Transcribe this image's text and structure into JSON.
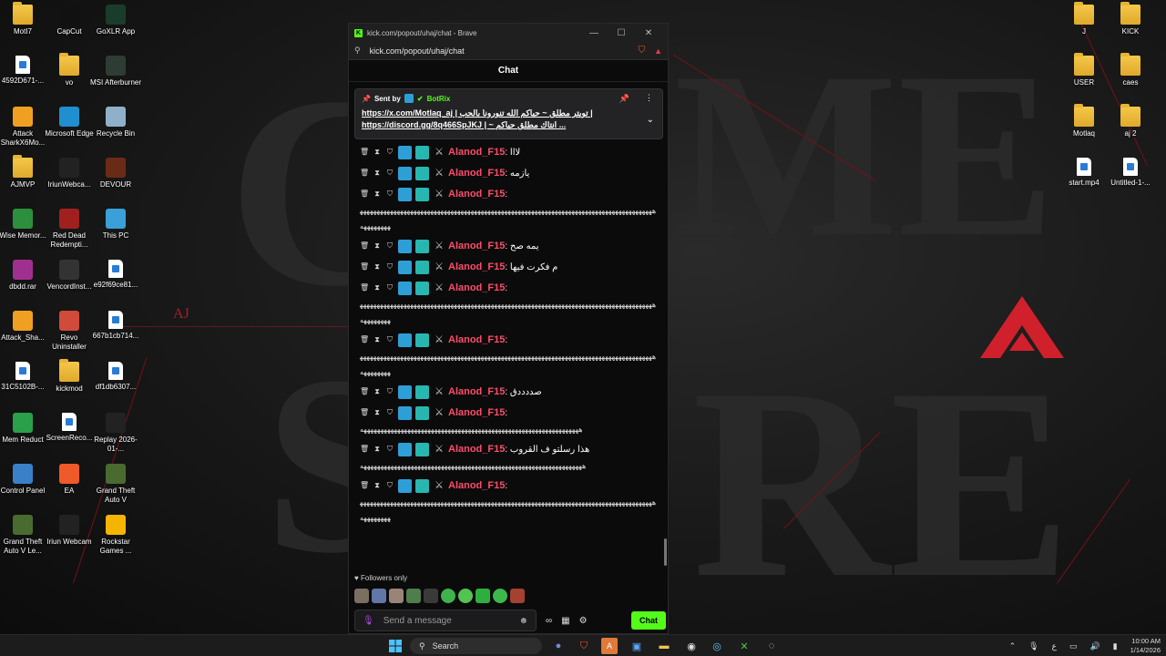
{
  "desktop": {
    "left_icons": [
      {
        "label": "MotI7",
        "type": "folder"
      },
      {
        "label": "CapCut",
        "type": "app"
      },
      {
        "label": "GoXLR App",
        "type": "app"
      },
      {
        "label": "4592D671-...",
        "type": "file"
      },
      {
        "label": "vo",
        "type": "folder"
      },
      {
        "label": "MSI Afterburner",
        "type": "app"
      },
      {
        "label": "Attack SharkX6Mo...",
        "type": "app"
      },
      {
        "label": "Microsoft Edge",
        "type": "app"
      },
      {
        "label": "Recycle Bin",
        "type": "app"
      },
      {
        "label": "AJMVP",
        "type": "folder"
      },
      {
        "label": "IriunWebca...",
        "type": "app"
      },
      {
        "label": "DEVOUR",
        "type": "app"
      },
      {
        "label": "Wise Memor...",
        "type": "app"
      },
      {
        "label": "Red Dead Redempti...",
        "type": "app"
      },
      {
        "label": "This PC",
        "type": "app"
      },
      {
        "label": "dbdd.rar",
        "type": "app"
      },
      {
        "label": "VencordInst...",
        "type": "app"
      },
      {
        "label": "e92f69ce81...",
        "type": "file"
      },
      {
        "label": "Attack_Sha...",
        "type": "app"
      },
      {
        "label": "Revo Uninstaller",
        "type": "app"
      },
      {
        "label": "667b1cb714...",
        "type": "file"
      },
      {
        "label": "31C5102B-...",
        "type": "file"
      },
      {
        "label": "kickmod",
        "type": "folder"
      },
      {
        "label": "df1db6307...",
        "type": "file"
      },
      {
        "label": "Mem Reduct",
        "type": "app"
      },
      {
        "label": "ScreenReco...",
        "type": "file"
      },
      {
        "label": "Replay 2026-01-...",
        "type": "app"
      },
      {
        "label": "Control Panel",
        "type": "app"
      },
      {
        "label": "EA",
        "type": "app"
      },
      {
        "label": "Grand Theft Auto V",
        "type": "app"
      },
      {
        "label": "Grand Theft Auto V Le...",
        "type": "app"
      },
      {
        "label": "Iriun Webcam",
        "type": "app"
      },
      {
        "label": "Rockstar Games ...",
        "type": "app"
      }
    ],
    "right_icons": [
      {
        "label": "J",
        "type": "folder"
      },
      {
        "label": "KICK",
        "type": "folder"
      },
      {
        "label": "USER",
        "type": "folder"
      },
      {
        "label": "caes",
        "type": "folder"
      },
      {
        "label": "Motlaq",
        "type": "folder"
      },
      {
        "label": "aj 2",
        "type": "folder"
      },
      {
        "label": "start.mp4",
        "type": "file"
      },
      {
        "label": "Untitled-1-...",
        "type": "file"
      }
    ],
    "wallpaper_mark": "AJ"
  },
  "window": {
    "title": "kick.com/popout/uhaj/chat - Brave",
    "url": "kick.com/popout/uhaj/chat",
    "chat_title": "Chat",
    "pinned": {
      "sent_by": "Sent by",
      "bot_name": "BotRix",
      "text_line1": "https://x.com/Motlaq_aj | تويتر مطلق ~ حياكم الله تنورونا بالحب |",
      "text_line2": "https://discord.gg/8q466SpJKJ | ~ انتاك مطلق حياكم ..."
    },
    "messages": [
      {
        "user": "Alanod_F15",
        "text": "لااا",
        "long": ""
      },
      {
        "user": "Alanod_F15",
        "text": "يازمه",
        "long": ""
      },
      {
        "user": "Alanod_F15",
        "text": "",
        "long": "ههههههههههههههههههههههههههههههههههههههههههههههههههههههههههههههههههههههههههههههههههههههههههههههههه"
      },
      {
        "user": "Alanod_F15",
        "text": "يمه صح",
        "long": ""
      },
      {
        "user": "Alanod_F15",
        "text": "م فكرت فيها",
        "long": ""
      },
      {
        "user": "Alanod_F15",
        "text": "",
        "long": "ههههههههههههههههههههههههههههههههههههههههههههههههههههههههههههههههههههههههههههههههههههههههههههههههه"
      },
      {
        "user": "Alanod_F15",
        "text": "",
        "long": "ههههههههههههههههههههههههههههههههههههههههههههههههههههههههههههههههههههههههههههههههههههههههههههههههه"
      },
      {
        "user": "Alanod_F15",
        "text": "صددددق",
        "long": ""
      },
      {
        "user": "Alanod_F15",
        "text": "",
        "long": "هههههههههههههههههههههههههههههههههههههههههههههههههههههههههههههههههه"
      },
      {
        "user": "Alanod_F15",
        "text": "هذا رسلتو ف القروب",
        "long": "ههههههههههههههههههههههههههههههههههههههههههههههههههههههههههههههههههه"
      },
      {
        "user": "Alanod_F15",
        "text": "",
        "long": "ههههههههههههههههههههههههههههههههههههههههههههههههههههههههههههههههههههههههههههههههههههههههههههههههه"
      }
    ],
    "followers_only": "Followers only",
    "input_placeholder": "Send a message",
    "send_label": "Chat"
  },
  "taskbar": {
    "search_label": "Search",
    "lang": "ع",
    "time": "10:00 AM",
    "date": "1/14/2026"
  },
  "colors": {
    "kick_green": "#53fc18",
    "username": "#ff4d6a",
    "accent_red": "#d0202c"
  }
}
